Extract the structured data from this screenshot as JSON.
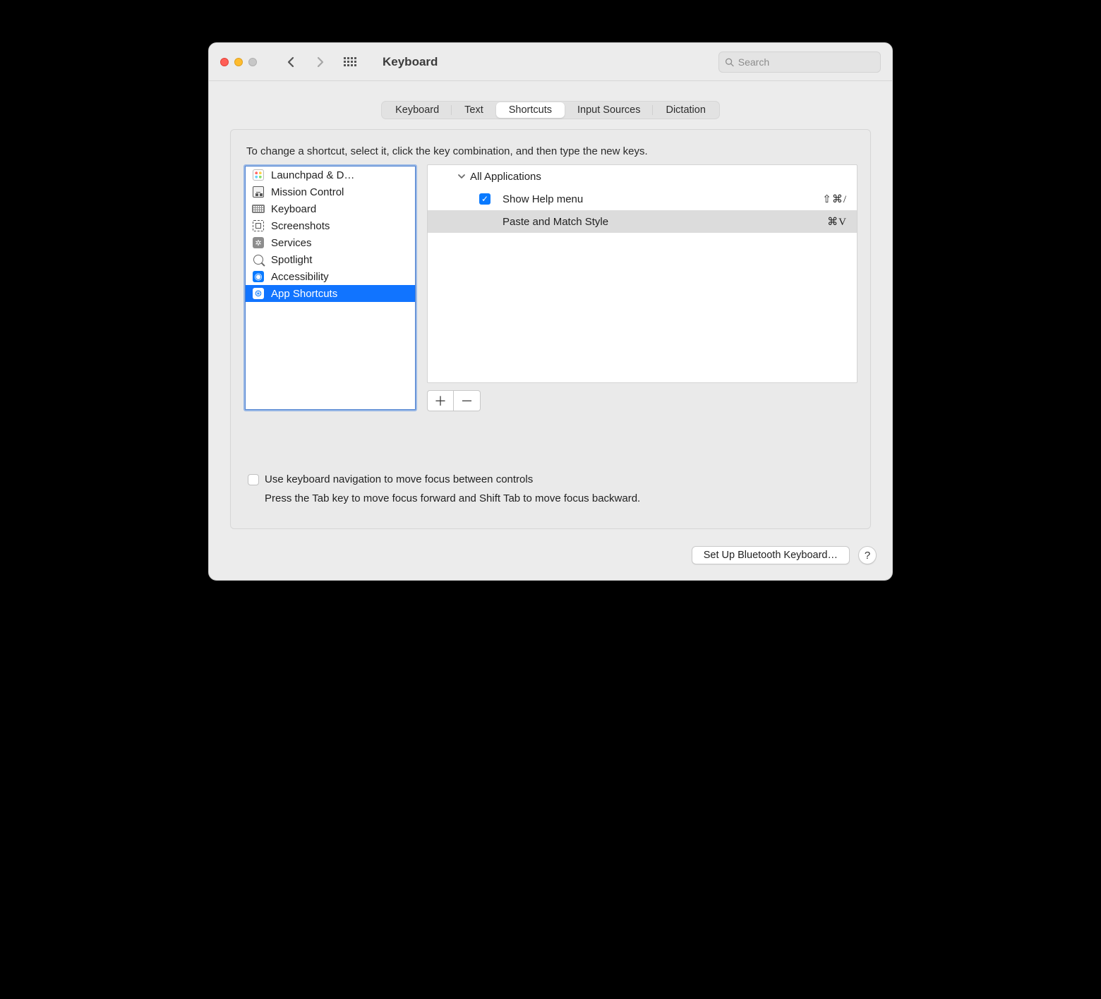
{
  "window": {
    "title": "Keyboard"
  },
  "search": {
    "placeholder": "Search",
    "value": ""
  },
  "tabs": [
    {
      "label": "Keyboard"
    },
    {
      "label": "Text"
    },
    {
      "label": "Shortcuts"
    },
    {
      "label": "Input Sources"
    },
    {
      "label": "Dictation"
    }
  ],
  "activeTab": 2,
  "instruction": "To change a shortcut, select it, click the key combination, and then type the new keys.",
  "categories": [
    {
      "label": "Launchpad & D…",
      "icon": "launchpad"
    },
    {
      "label": "Mission Control",
      "icon": "mission"
    },
    {
      "label": "Keyboard",
      "icon": "keyboard"
    },
    {
      "label": "Screenshots",
      "icon": "screens"
    },
    {
      "label": "Services",
      "icon": "services"
    },
    {
      "label": "Spotlight",
      "icon": "spot"
    },
    {
      "label": "Accessibility",
      "icon": "access"
    },
    {
      "label": "App Shortcuts",
      "icon": "appsh"
    }
  ],
  "selectedCategory": 7,
  "shortcutGroup": {
    "label": "All Applications"
  },
  "shortcuts": [
    {
      "enabled": true,
      "label": "Show Help menu",
      "keys": "⇧⌘/",
      "selected": false
    },
    {
      "enabled": false,
      "label": "Paste and Match Style",
      "keys": "⌘V",
      "selected": true
    }
  ],
  "checkbox": {
    "label": "Use keyboard navigation to move focus between controls",
    "hint": "Press the Tab key to move focus forward and Shift Tab to move focus backward."
  },
  "footer": {
    "bluetooth": "Set Up Bluetooth Keyboard…",
    "help": "?"
  }
}
